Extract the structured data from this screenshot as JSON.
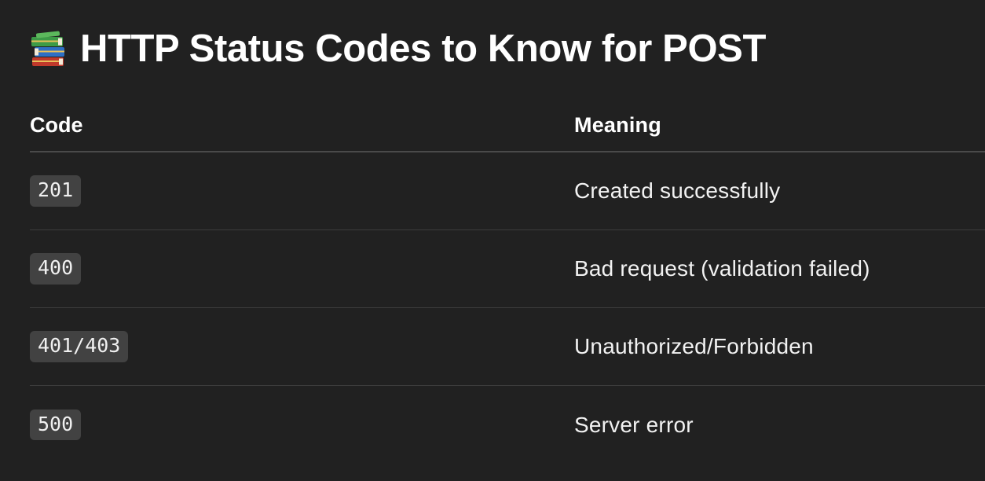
{
  "page": {
    "title": "HTTP Status Codes to Know for POST",
    "title_icon": "books-icon"
  },
  "table": {
    "headers": {
      "code": "Code",
      "meaning": "Meaning"
    },
    "rows": [
      {
        "code": "201",
        "meaning": "Created successfully"
      },
      {
        "code": "400",
        "meaning": "Bad request (validation failed)"
      },
      {
        "code": "401/403",
        "meaning": "Unauthorized/Forbidden"
      },
      {
        "code": "500",
        "meaning": "Server error"
      }
    ]
  },
  "colors": {
    "background": "#212121",
    "code_chip_bg": "#424242",
    "divider": "#3c3c3c",
    "text": "#ffffff"
  }
}
